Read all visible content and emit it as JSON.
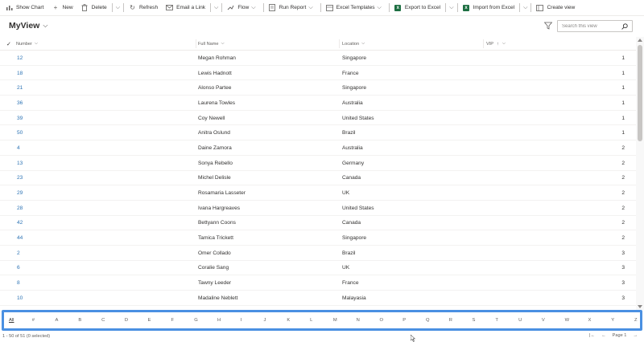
{
  "toolbar": {
    "show_chart": "Show Chart",
    "new": "New",
    "delete": "Delete",
    "refresh": "Refresh",
    "email_link": "Email a Link",
    "flow": "Flow",
    "run_report": "Run Report",
    "excel_templates": "Excel Templates",
    "export_excel": "Export to Excel",
    "import_excel": "Import from Excel",
    "create_view": "Create view"
  },
  "view": {
    "title": "MyView",
    "search_placeholder": "Search this view"
  },
  "columns": {
    "number": "Number",
    "full_name": "Full Name",
    "location": "Location",
    "vip": "VIP"
  },
  "rows": [
    {
      "number": "12",
      "name": "Megan Rohman",
      "location": "Singapore",
      "vip": "1"
    },
    {
      "number": "18",
      "name": "Lewis Hadnott",
      "location": "France",
      "vip": "1"
    },
    {
      "number": "21",
      "name": "Alonso Partee",
      "location": "Singapore",
      "vip": "1"
    },
    {
      "number": "36",
      "name": "Laurena Towles",
      "location": "Australia",
      "vip": "1"
    },
    {
      "number": "39",
      "name": "Coy Newell",
      "location": "United States",
      "vip": "1"
    },
    {
      "number": "50",
      "name": "Anitra Oslund",
      "location": "Brazil",
      "vip": "1"
    },
    {
      "number": "4",
      "name": "Daine Zamora",
      "location": "Australia",
      "vip": "2"
    },
    {
      "number": "13",
      "name": "Sonya Rebello",
      "location": "Germany",
      "vip": "2"
    },
    {
      "number": "23",
      "name": "Michel Delisle",
      "location": "Canada",
      "vip": "2"
    },
    {
      "number": "29",
      "name": "Rosamaria Lasseter",
      "location": "UK",
      "vip": "2"
    },
    {
      "number": "28",
      "name": "Ivana Hargreaves",
      "location": "United States",
      "vip": "2"
    },
    {
      "number": "42",
      "name": "Bettyann Coons",
      "location": "Canada",
      "vip": "2"
    },
    {
      "number": "44",
      "name": "Tamica Trickett",
      "location": "Singapore",
      "vip": "2"
    },
    {
      "number": "2",
      "name": "Omer Collado",
      "location": "Brazil",
      "vip": "3"
    },
    {
      "number": "6",
      "name": "Coralie Sang",
      "location": "UK",
      "vip": "3"
    },
    {
      "number": "8",
      "name": "Tawny Leeder",
      "location": "France",
      "vip": "3"
    },
    {
      "number": "10",
      "name": "Madaline Neblett",
      "location": "Malayasia",
      "vip": "3"
    }
  ],
  "alphabet": [
    "All",
    "#",
    "A",
    "B",
    "C",
    "D",
    "E",
    "F",
    "G",
    "H",
    "I",
    "J",
    "K",
    "L",
    "M",
    "N",
    "O",
    "P",
    "Q",
    "R",
    "S",
    "T",
    "U",
    "V",
    "W",
    "X",
    "Y",
    "Z"
  ],
  "footer": {
    "status": "1 - 50 of 51 (0 selected)",
    "page": "Page 1"
  },
  "colors": {
    "highlight": "#4a90e2",
    "link": "#2e74b5",
    "excel_green": "#1d6f42"
  }
}
